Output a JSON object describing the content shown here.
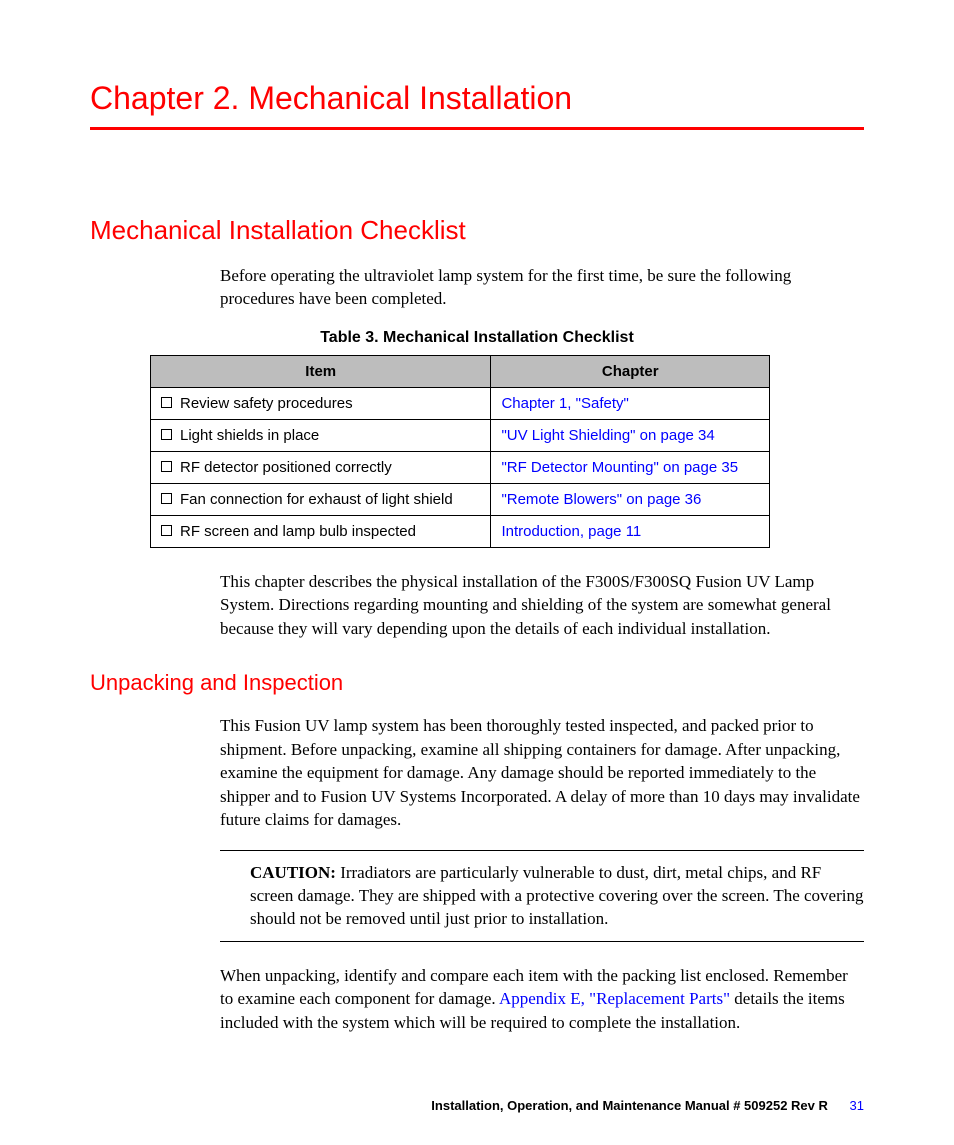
{
  "chapter_title": "Chapter 2.  Mechanical Installation",
  "section1": {
    "heading": "Mechanical Installation Checklist",
    "intro": "Before operating the ultraviolet lamp system for the first time, be sure the following procedures have been completed.",
    "table_caption": "Table 3. Mechanical Installation Checklist",
    "table": {
      "headers": [
        "Item",
        "Chapter"
      ],
      "rows": [
        {
          "item": "Review safety procedures",
          "chapter": "Chapter 1, \"Safety\""
        },
        {
          "item": "Light shields in place",
          "chapter": "\"UV Light Shielding\" on page 34"
        },
        {
          "item": "RF detector positioned correctly",
          "chapter": "\"RF Detector Mounting\" on page 35"
        },
        {
          "item": "Fan connection for exhaust of light shield",
          "chapter": "\"Remote Blowers\" on page 36"
        },
        {
          "item": "RF screen and lamp bulb inspected",
          "chapter": "Introduction, page 11"
        }
      ]
    },
    "desc": "This chapter describes the physical installation of the F300S/F300SQ Fusion UV Lamp System. Directions regarding mounting and shielding of the system are somewhat general because they will vary depending upon the details of each individual installation."
  },
  "section2": {
    "heading": "Unpacking and Inspection",
    "para1": "This Fusion UV lamp system has been thoroughly tested inspected, and packed prior to shipment. Before unpacking, examine all shipping containers for damage. After unpacking, examine the equipment for damage. Any damage should be reported immediately to the shipper and to Fusion UV Systems Incorporated. A delay of more than 10 days may invalidate future claims for damages.",
    "caution_label": "CAUTION: ",
    "caution_text": "Irradiators are particularly vulnerable to dust, dirt, metal chips, and RF screen damage. They are shipped with a protective covering over the screen. The covering should not be removed until just prior to installation.",
    "para2_a": "When unpacking, identify and compare each item with the packing list enclosed. Remember to examine each component for damage. ",
    "para2_link": "Appendix E, \"Replacement Parts\"",
    "para2_b": " details the items included with the system which will be required to complete the installation."
  },
  "footer": {
    "text": "Installation, Operation, and Maintenance Manual  # 509252 Rev R",
    "page": "31"
  }
}
